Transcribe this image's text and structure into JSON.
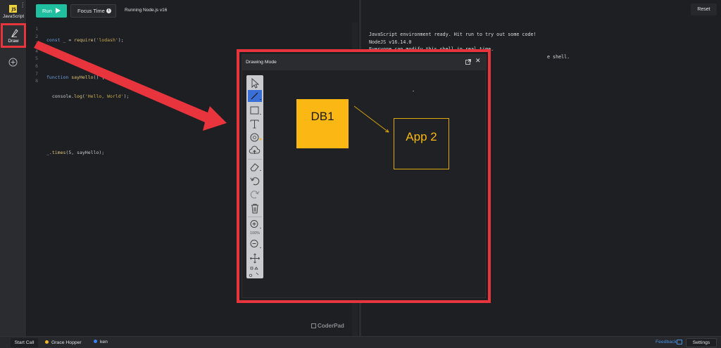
{
  "rail": {
    "language": "JavaScript",
    "language_badge": "JS",
    "draw_label": "Draw"
  },
  "toolbar": {
    "run_label": "Run",
    "focus_label": "Focus Time",
    "info_glyph": "i",
    "runtime_label": "Running Node.js v16"
  },
  "editor": {
    "line_numbers": [
      "1",
      "2",
      "3",
      "4",
      "5",
      "6",
      "7",
      "8"
    ],
    "logo": "CoderPad"
  },
  "console": {
    "reset_label": "Reset",
    "lines": [
      "JavaScript environment ready. Hit run to try out some code!",
      "NodeJS v16.14.0",
      "Everyone can modify this shell in real time.",
      "e shell."
    ]
  },
  "drawing_modal": {
    "title": "Drawing Mode",
    "close_glyph": "✕",
    "zoom_level": "100%",
    "shapes": {
      "db1_label": "DB1",
      "app2_label": "App 2"
    }
  },
  "status_bar": {
    "start_call": "Start Call",
    "users": [
      {
        "name": "Grace Hopper",
        "color": "#f0b429"
      },
      {
        "name": "ken",
        "color": "#3b82f6"
      }
    ],
    "feedback": "Feedback",
    "settings": "Settings"
  },
  "colors": {
    "accent_run": "#1fbf9f",
    "highlight_red": "#e8343c",
    "sticky_yellow": "#fbb814"
  }
}
